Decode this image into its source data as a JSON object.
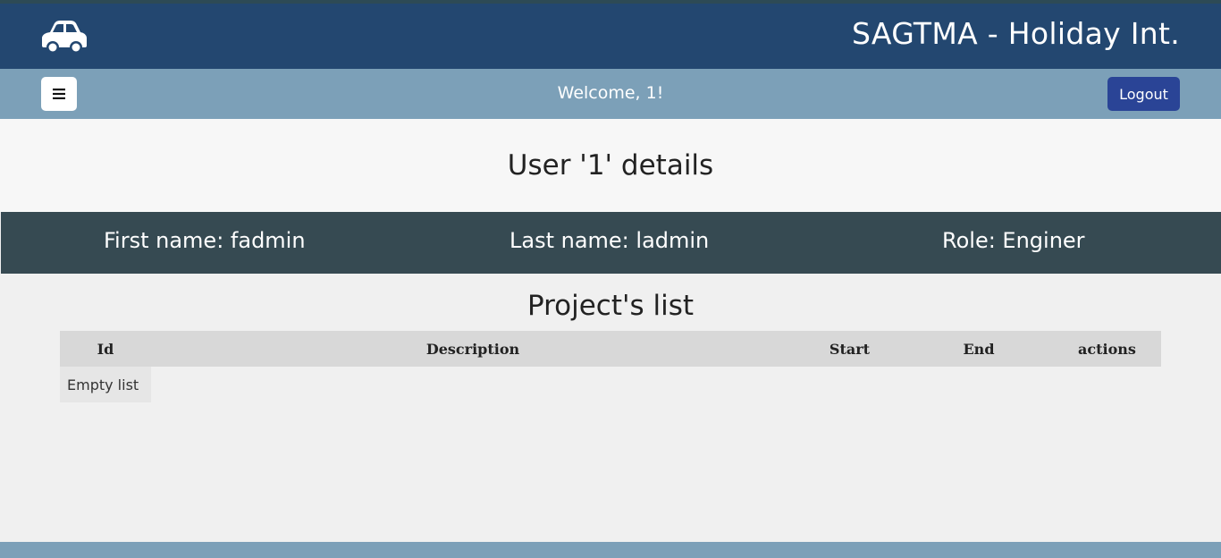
{
  "header": {
    "logo_icon": "car-icon",
    "title": "SAGTMA - Holiday Int.",
    "background": "#234770"
  },
  "navbar": {
    "menu_icon": "menu-icon",
    "menu_glyph": "☰",
    "welcome": "Welcome, 1!",
    "logout_label": "Logout",
    "background": "#7ca0b8",
    "logout_color": "#2a4496"
  },
  "user": {
    "heading": "User '1' details",
    "first_name": "First name: fadmin",
    "last_name": "Last name: ladmin",
    "role": "Role: Enginer",
    "band_color": "#364a52"
  },
  "projects": {
    "title": "Project's list",
    "columns": [
      "Id",
      "Description",
      "Start",
      "End",
      "actions"
    ],
    "empty_text": "Empty list"
  }
}
